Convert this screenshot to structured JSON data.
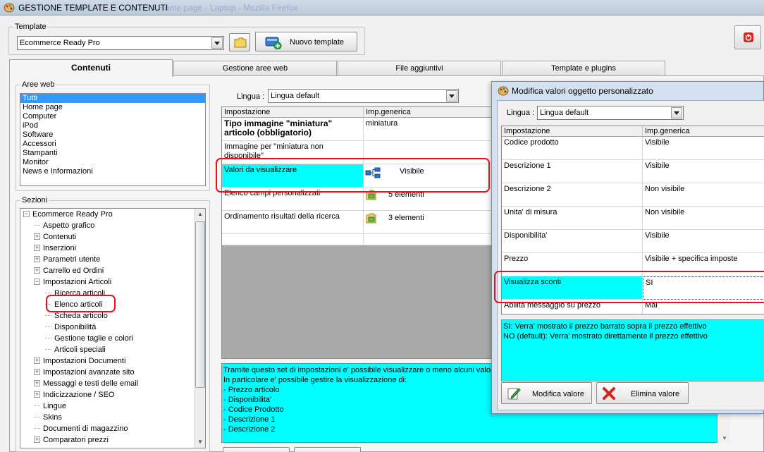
{
  "window": {
    "title": "GESTIONE TEMPLATE E CONTENUTI",
    "background_title": "Home page - Laptop - Mozilla Firefox"
  },
  "template_group": {
    "legend": "Template",
    "selected": "Ecommerce Ready Pro",
    "new_template_label": "Nuovo template"
  },
  "tabs": [
    {
      "label": "Contenuti",
      "active": true
    },
    {
      "label": "Gestione aree web",
      "active": false
    },
    {
      "label": "File aggiuntivi",
      "active": false
    },
    {
      "label": "Template e plugins",
      "active": false
    }
  ],
  "aree_web": {
    "legend": "Aree web",
    "items": [
      "Tutti",
      "Home page",
      "Computer",
      "iPod",
      "Software",
      "Accessori",
      "Stampanti",
      "Monitor",
      "News e Informazioni"
    ],
    "selected_index": 0
  },
  "sezioni": {
    "legend": "Sezioni",
    "items": [
      {
        "label": "Ecommerce Ready Pro",
        "level": 0,
        "expander": "minus"
      },
      {
        "label": "Aspetto grafico",
        "level": 1,
        "expander": "none"
      },
      {
        "label": "Contenuti",
        "level": 1,
        "expander": "plus"
      },
      {
        "label": "Inserzioni",
        "level": 1,
        "expander": "plus"
      },
      {
        "label": "Parametri utente",
        "level": 1,
        "expander": "plus"
      },
      {
        "label": "Carrello ed Ordini",
        "level": 1,
        "expander": "plus"
      },
      {
        "label": "Impostazioni Articoli",
        "level": 1,
        "expander": "minus"
      },
      {
        "label": "Ricerca articoli",
        "level": 2,
        "expander": "none"
      },
      {
        "label": "Elenco articoli",
        "level": 2,
        "expander": "none"
      },
      {
        "label": "Scheda articolo",
        "level": 2,
        "expander": "none"
      },
      {
        "label": "Disponibilità",
        "level": 2,
        "expander": "none"
      },
      {
        "label": "Gestione taglie e colori",
        "level": 2,
        "expander": "none"
      },
      {
        "label": "Articoli speciali",
        "level": 2,
        "expander": "none"
      },
      {
        "label": "Impostazioni Documenti",
        "level": 1,
        "expander": "plus"
      },
      {
        "label": "Impostazioni avanzate sito",
        "level": 1,
        "expander": "plus"
      },
      {
        "label": "Messaggi e testi delle email",
        "level": 1,
        "expander": "plus"
      },
      {
        "label": "Indicizzazione / SEO",
        "level": 1,
        "expander": "plus"
      },
      {
        "label": "Lingue",
        "level": 1,
        "expander": "none"
      },
      {
        "label": "Skins",
        "level": 1,
        "expander": "none"
      },
      {
        "label": "Documenti di magazzino",
        "level": 1,
        "expander": "none"
      },
      {
        "label": "Comparatori prezzi",
        "level": 1,
        "expander": "plus"
      }
    ]
  },
  "main": {
    "lingua_label": "Lingua :",
    "lingua_value": "Lingua default",
    "headers": [
      "Impostazione",
      "Imp.generica"
    ],
    "rows": [
      {
        "setting": "Tipo immagine \"miniatura\" articolo (obbligatorio)",
        "value": "miniatura",
        "icon": "",
        "bold": true,
        "cyan": false
      },
      {
        "setting": "Immagine per \"miniatura non disponibile\"",
        "value": "",
        "icon": "",
        "bold": false,
        "cyan": false
      },
      {
        "setting": "Valori da visualizzare",
        "value": "Visibile",
        "icon": "hierarchy-icon",
        "bold": false,
        "cyan": true
      },
      {
        "setting": "Elenco campi personalizzati",
        "value": "5 elementi",
        "icon": "folder-list-icon",
        "bold": false,
        "cyan": false
      },
      {
        "setting": "Ordinamento risultati della ricerca",
        "value": "3 elementi",
        "icon": "folder-list-icon",
        "bold": false,
        "cyan": false
      }
    ],
    "description": [
      "Tramite questo set di impostazioni e' possibile visualizzare o meno alcuni valori",
      "In particolare e' possibile gestire la visualizzazione di:",
      "- Prezzo articolo",
      "- Disponibilita'",
      "- Codice Prodotto",
      "- Descrizione 1",
      "- Descrizione 2"
    ]
  },
  "dialog": {
    "title": "Modifica valori oggetto personalizzato",
    "lingua_label": "Lingua :",
    "lingua_value": "Lingua default",
    "headers": [
      "Impostazione",
      "Imp.generica"
    ],
    "rows": [
      {
        "setting": "Codice prodotto",
        "value": "Visibile"
      },
      {
        "setting": "Descrizione 1",
        "value": "Visibile"
      },
      {
        "setting": "Descrizione 2",
        "value": "Non visibile"
      },
      {
        "setting": "Unita' di misura",
        "value": "Non visibile"
      },
      {
        "setting": "Disponibilita'",
        "value": "Visibile"
      },
      {
        "setting": "Prezzo",
        "value": "Visibile + specifica imposte"
      },
      {
        "setting": "Visualizza sconti",
        "value": "SI"
      },
      {
        "setting": "Abilita messaggio su prezzo",
        "value": "Mai"
      }
    ],
    "help_text": [
      "SI: Verra' mostrato il prezzo barrato sopra il prezzo effettivo",
      "NO (default): Verra' mostrato direttamente il prezzo effettivo"
    ],
    "modify_label": "Modifica valore",
    "delete_label": "Elimina valore"
  },
  "colors": {
    "highlight_cyan": "#00ffff",
    "selection_blue": "#3399ff",
    "annotation_red": "#e8101c"
  }
}
